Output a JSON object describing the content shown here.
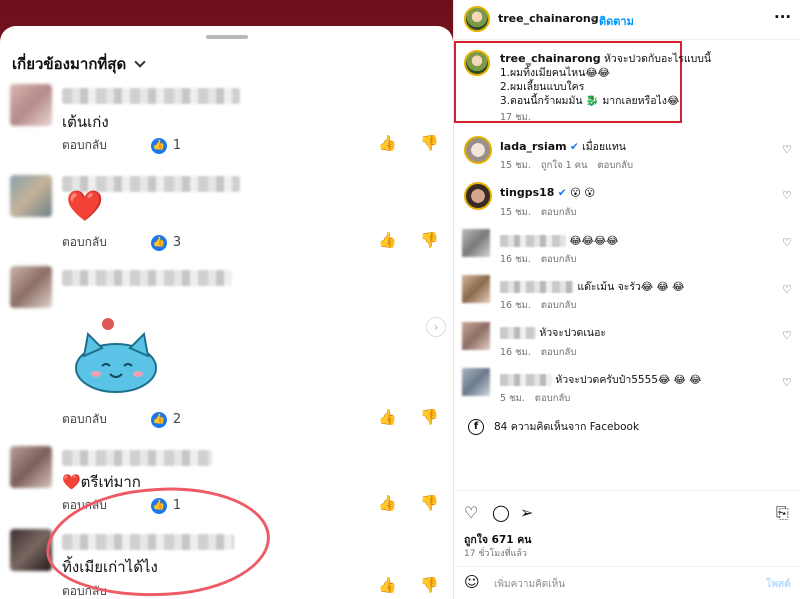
{
  "facebook": {
    "sort_label": "เกี่ยวข้องมากที่สุด",
    "reply_label": "ตอบกลับ",
    "comments": [
      {
        "text": "เต้นเก่ง",
        "likes": "1"
      },
      {
        "text": "",
        "likes": "3",
        "sticker": "❤️"
      },
      {
        "text": "",
        "likes": "2",
        "sticker": "cat"
      },
      {
        "text": "❤️ตรีเท่มาก",
        "likes": "1"
      },
      {
        "text": "ทิ้งเมียเก่าได้ไง",
        "likes": ""
      }
    ]
  },
  "instagram": {
    "header": {
      "username": "tree_chainarong",
      "follow_label": "ติดตาม",
      "more": "···"
    },
    "caption": {
      "username": "tree_chainarong",
      "line1": "หัวจะปวดกับอะไรแบบนี้",
      "line2": "1.ผมทิ้งเมียคนไหน😂😂",
      "line3": "2.ผมเลี้ยนแบบใคร",
      "line4": "3.ตอนนี้กร้าผมมัน 🐉 มากเลยหรือไง😂",
      "time": "17 ชม."
    },
    "comments": [
      {
        "username": "lada_rsiam",
        "text": "เมื่อยแทน",
        "time": "15 ชม.",
        "likes": "ถูกใจ 1 คน",
        "reply": "ตอบกลับ"
      },
      {
        "username": "tingps18",
        "text": "😮 😮",
        "time": "15 ชม.",
        "reply": "ตอบกลับ"
      },
      {
        "username": "",
        "text": "😂😂😂😂",
        "time": "16 ชม.",
        "reply": "ตอบกลับ"
      },
      {
        "username": "",
        "text": "แด๊ะเม้น จะรัว😂 😂 😂",
        "time": "16 ชม.",
        "reply": "ตอบกลับ"
      },
      {
        "username": "",
        "text": "หัวจะปวดเนอะ",
        "time": "16 ชม.",
        "reply": "ตอบกลับ"
      },
      {
        "username": "",
        "text": "หัวจะปวดครับป๋า5555😂 😂 😂",
        "time": "5 ชม.",
        "reply": "ตอบกลับ"
      }
    ],
    "fb_comments": "84 ความคิดเห็นจาก Facebook",
    "likes": "ถูกใจ 671 คน",
    "posted": "17 ชั่วโมงที่แล้ว",
    "comment_placeholder": "เพิ่มความคิดเห็น",
    "post_label": "โพสต์"
  }
}
